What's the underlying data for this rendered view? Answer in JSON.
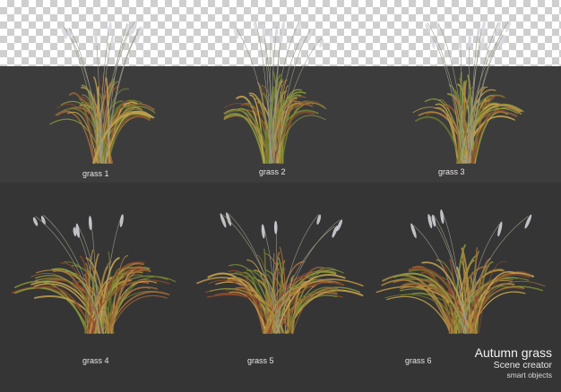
{
  "items": [
    {
      "label": "grass 1"
    },
    {
      "label": "grass 2"
    },
    {
      "label": "grass 3"
    },
    {
      "label": "grass 4"
    },
    {
      "label": "grass 5"
    },
    {
      "label": "grass 6"
    }
  ],
  "title": {
    "main": "Autumn grass",
    "sub": "Scene creator",
    "small": "smart objects"
  },
  "colors": {
    "checker_light": "#ffffff",
    "checker_dark": "#cfcfcf",
    "panel_top": "#3c3c3c",
    "panel_bottom": "#353535",
    "blade_green": "#8a9a3a",
    "blade_gold": "#c4a24e",
    "blade_rust": "#8c4a2c",
    "plume": "#d8d8e0"
  }
}
